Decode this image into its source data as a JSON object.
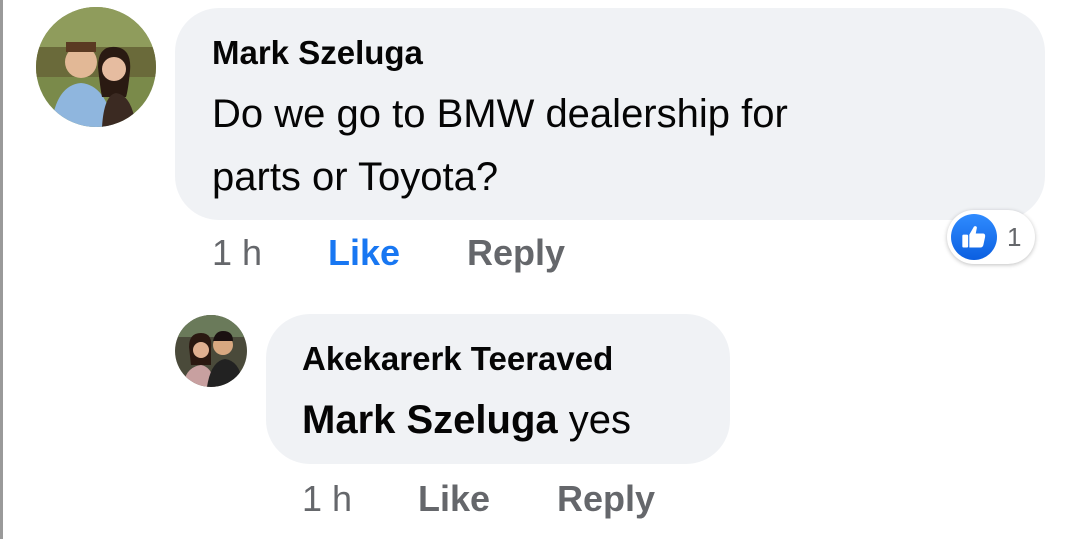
{
  "comments": [
    {
      "author": "Mark Szeluga",
      "text_lines": [
        "Do we go to BMW dealership for",
        "parts or Toyota?"
      ],
      "time": "1 h",
      "like_label": "Like",
      "reply_label": "Reply",
      "like_active": true,
      "reaction": {
        "icon": "thumbs-up-icon",
        "count": "1"
      }
    },
    {
      "author": "Akekarerk Teeraved",
      "mention": "Mark Szeluga",
      "text": " yes",
      "time": "1 h",
      "like_label": "Like",
      "reply_label": "Reply",
      "like_active": false
    }
  ],
  "colors": {
    "bubble": "#f0f2f5",
    "like_active": "#1877f2",
    "meta": "#65676b"
  }
}
